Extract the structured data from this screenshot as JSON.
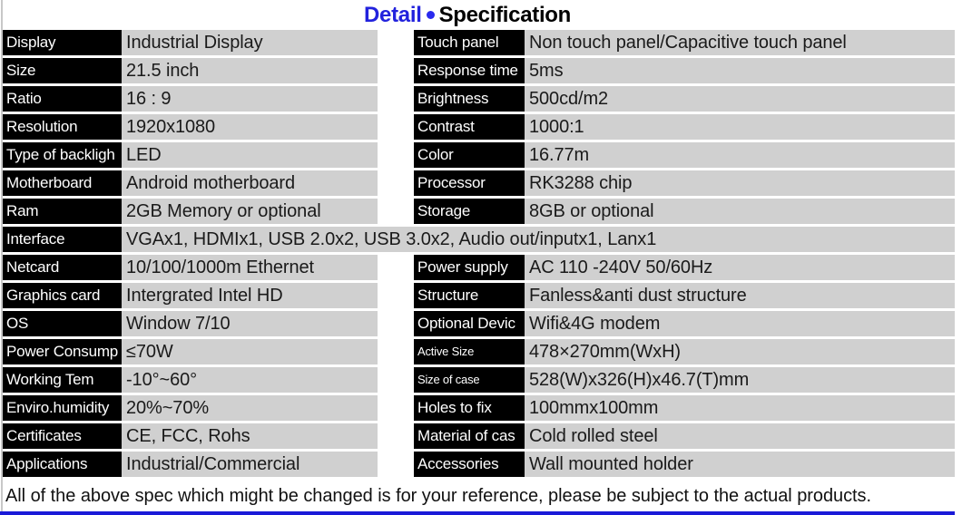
{
  "title": {
    "part1": "Detail",
    "separator": "bullet",
    "part2": "Specification"
  },
  "colors": {
    "title_accent": "#2222dd",
    "label_bg": "#000000",
    "label_text": "#ffffff",
    "value_bg": "#d0d0d0",
    "bottom_bar": "#1a1ad8"
  },
  "rows": [
    {
      "left_label": "Display",
      "left_value": "Industrial Display",
      "right_label": "Touch panel",
      "right_value": "Non touch panel/Capacitive touch panel"
    },
    {
      "left_label": "Size",
      "left_value": "21.5 inch",
      "right_label": "Response time",
      "right_value": "5ms"
    },
    {
      "left_label": "Ratio",
      "left_value": "16 : 9",
      "right_label": "Brightness",
      "right_value": "500cd/m2"
    },
    {
      "left_label": "Resolution",
      "left_value": "1920x1080",
      "right_label": "Contrast",
      "right_value": "1000:1"
    },
    {
      "left_label": "Type of backligh",
      "left_value": "LED",
      "right_label": "Color",
      "right_value": "16.77m"
    },
    {
      "left_label": "Motherboard",
      "left_value": "Android motherboard",
      "right_label": "Processor",
      "right_value": "RK3288 chip"
    },
    {
      "left_label": "Ram",
      "left_value": "2GB Memory or optional",
      "right_label": "Storage",
      "right_value": "8GB or optional"
    },
    {
      "left_label": "Interface",
      "full_value": "VGAx1, HDMIx1, USB 2.0x2, USB 3.0x2, Audio out/inputx1, Lanx1"
    },
    {
      "left_label": "Netcard",
      "left_value": "10/100/1000m Ethernet",
      "right_label": "Power supply",
      "right_value": "AC 110 -240V  50/60Hz"
    },
    {
      "left_label": "Graphics card",
      "left_value": "Intergrated Intel HD",
      "right_label": "Structure",
      "right_value": "Fanless&anti dust structure"
    },
    {
      "left_label": "OS",
      "left_value": "Window 7/10",
      "right_label": "Optional Devic",
      "right_value": "Wifi&4G modem"
    },
    {
      "left_label": "Power Consump",
      "left_value": "≤70W",
      "right_label": "Active Size",
      "right_value": "478×270mm(WxH)"
    },
    {
      "left_label": "Working Tem",
      "left_value": "-10°~60°",
      "right_label": "Size of case",
      "right_value": "528(W)x326(H)x46.7(T)mm"
    },
    {
      "left_label": "Enviro.humidity",
      "left_value": "20%~70%",
      "right_label": "Holes to fix",
      "right_value": "100mmx100mm"
    },
    {
      "left_label": "Certificates",
      "left_value": "CE, FCC, Rohs",
      "right_label": "Material of cas",
      "right_value": "Cold rolled steel"
    },
    {
      "left_label": "Applications",
      "left_value": "Industrial/Commercial",
      "right_label": "Accessories",
      "right_value": "Wall mounted holder"
    }
  ],
  "footer_note": "All of the above spec which might be changed is for your reference, please be subject to the actual products."
}
